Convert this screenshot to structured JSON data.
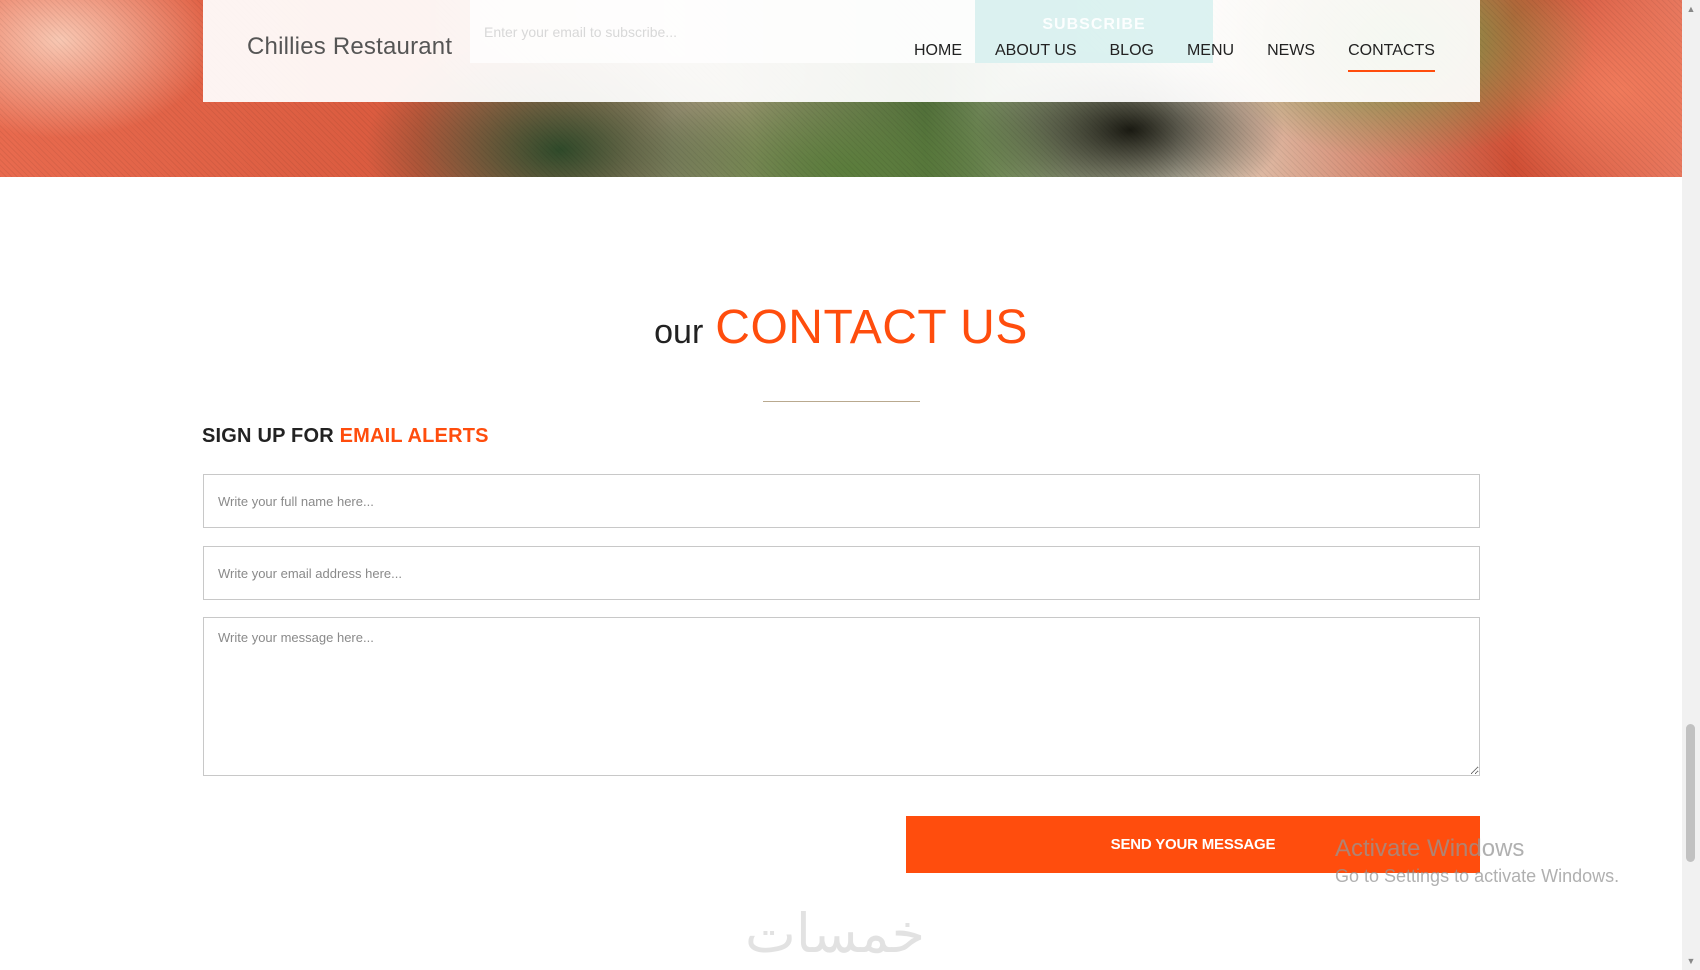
{
  "header": {
    "brand": "Chillies Restaurant",
    "subscribe_placeholder": "Enter your email to subscribe...",
    "subscribe_button": "SUBSCRIBE",
    "nav": [
      {
        "label": "HOME"
      },
      {
        "label": "ABOUT US"
      },
      {
        "label": "BLOG"
      },
      {
        "label": "MENU"
      },
      {
        "label": "NEWS"
      },
      {
        "label": "CONTACTS",
        "active": true
      }
    ]
  },
  "contact": {
    "heading_prefix": "our",
    "heading_main": "CONTACT US",
    "alerts_prefix": "SIGN UP FOR",
    "alerts_accent": "EMAIL ALERTS",
    "name_placeholder": "Write your full name here...",
    "email_placeholder": "Write your email address here...",
    "message_placeholder": "Write your message here...",
    "send_button": "SEND YOUR MESSAGE"
  },
  "overlay": {
    "activate_title": "Activate Windows",
    "activate_sub": "Go to Settings to activate Windows.",
    "logo_text": "خمسات"
  },
  "colors": {
    "accent": "#ff4d0d",
    "text_dark": "#222222",
    "divider": "#b9a98f"
  }
}
